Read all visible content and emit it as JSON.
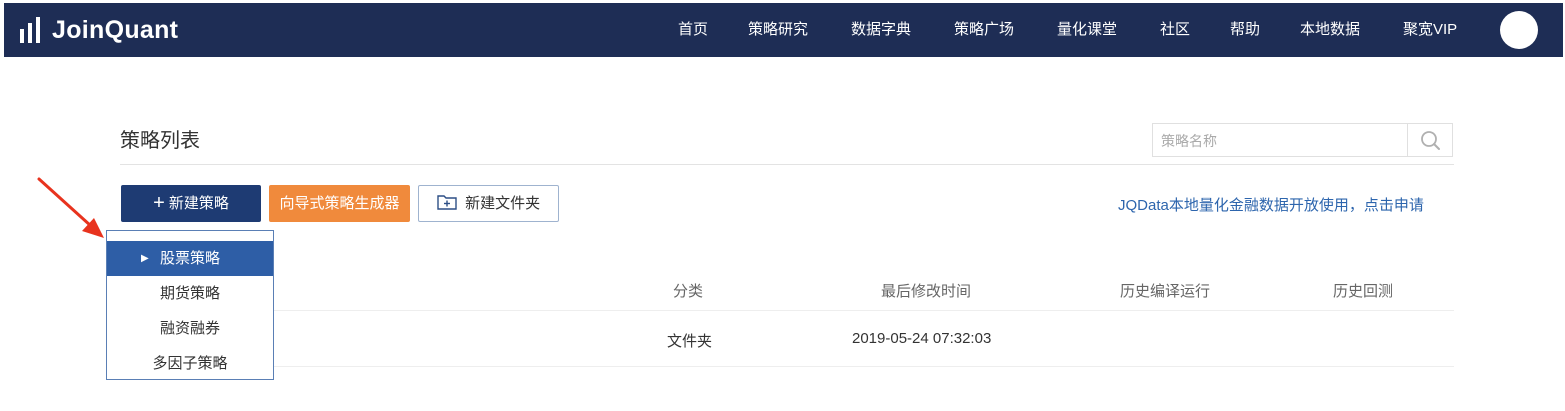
{
  "header": {
    "logo_text": "JoinQuant",
    "nav": [
      "首页",
      "策略研究",
      "数据字典",
      "策略广场",
      "量化课堂",
      "社区",
      "帮助",
      "本地数据",
      "聚宽VIP"
    ],
    "colors": {
      "background": "#1e2d55"
    }
  },
  "main": {
    "title": "策略列表",
    "search": {
      "placeholder": "策略名称",
      "icon": "search-icon"
    },
    "buttons": {
      "new_strategy": "新建策略",
      "wizard": "向导式策略生成器",
      "new_folder": "新建文件夹"
    },
    "jqdata_link": "JQData本地量化金融数据开放使用，点击申请",
    "table": {
      "headers": [
        "分类",
        "最后修改时间",
        "历史编译运行",
        "历史回测"
      ],
      "rows": [
        {
          "category": "文件夹",
          "modified": "2019-05-24 07:32:03"
        }
      ]
    }
  },
  "dropdown": {
    "items": [
      "股票策略",
      "期货策略",
      "融资融券",
      "多因子策略"
    ],
    "active_index": 0
  },
  "colors": {
    "primary": "#1e3b73",
    "wizard": "#f08a3c",
    "link": "#2d65ad",
    "dropdown_active": "#2e5ea6",
    "arrow": "#e8331e"
  }
}
